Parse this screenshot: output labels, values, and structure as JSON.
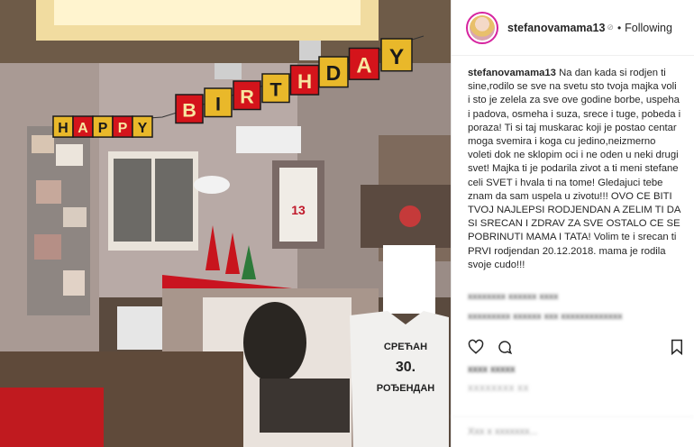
{
  "post": {
    "username": "stefanovamama13",
    "verified_mark": "⊘",
    "separator": "•",
    "follow_status": "Following",
    "caption": "Na dan kada si rodjen ti sine,rodilo se sve na svetu sto tvoja majka voli i sto je zelela za sve ove godine borbe, uspeha i padova, osmeha i suza, srece i tuge, pobeda i poraza! Ti si taj muskarac koji je postao centar moga svemira i koga cu jedino,neizmerno voleti dok ne sklopim oci i ne oden u neki drugi svet! Majka ti je podarila zivot a ti meni stefane celi SVET i hvala ti na tome! Gledajuci tebe znam da sam uspela u zivotu!!! OVO CE BITI TVOJ NAJLEPSI RODJENDAN A ZELIM TI DA SI SRECAN I ZDRAV ZA SVE OSTALO CE SE POBRINUTI MAMA I TATA! Volim te i srecan ti PRVI rodjendan 20.12.2018. mama je rodila svoje cudo!!!"
  },
  "photo": {
    "banner_letters": [
      "H",
      "A",
      "P",
      "P",
      "Y",
      "B",
      "I",
      "R",
      "T",
      "H",
      "D",
      "A",
      "Y"
    ],
    "shirt_line1": "СРЕЋАН",
    "shirt_line2": "30.",
    "shirt_line3": "РОЂЕНДАН",
    "jersey_number": "13"
  },
  "blurred": {
    "comment1": "xxxxxxxx xxxxxx xxxx",
    "comment2": "xxxxxxxxx xxxxxx xxx xxxxxxxxxxxxx",
    "likes": "xxxx xxxxx",
    "date": "XXXXXXXX XX",
    "add_comment": "Xxx x xxxxxxx..."
  },
  "icons": [
    "heart-icon",
    "comment-icon",
    "bookmark-icon",
    "avatar"
  ],
  "colors": {
    "counter_red": "#d4141b",
    "accent_ring": "#d6249f"
  }
}
